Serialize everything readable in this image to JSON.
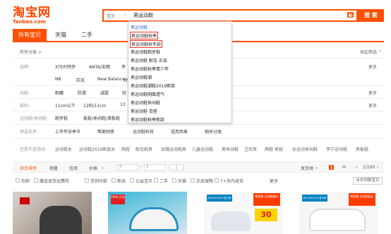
{
  "header": {
    "logo_main": "淘宝网",
    "logo_sub": "Taobao.com",
    "search_category": "宝贝",
    "search_value": "男运动鞋",
    "search_button": "搜 索"
  },
  "tabs": [
    {
      "label": "所有宝贝",
      "active": true
    },
    {
      "label": "天猫",
      "active": false
    },
    {
      "label": "二手",
      "active": false
    }
  ],
  "crumb": "所有分类 >",
  "collapse_filter": "收起筛选 ^",
  "filters": {
    "brand_label": "品牌:",
    "brand_row1": [
      "XTEP/特步",
      "ANTA/安踏",
      "李"
    ],
    "brand_row2": [
      "NB",
      "匹克",
      "New Balance",
      "特"
    ],
    "function_label": "功能:",
    "functions": [
      "耐磨",
      "防滑",
      "减震",
      "轻"
    ],
    "size_label": "鞋码:",
    "sizes": [
      "11cm以下",
      "12码/11cm",
      "13"
    ],
    "more": "更多",
    "scene_label": "运动鞋/休闲鞋:",
    "scenes": [
      "跑步鞋",
      "板鞋/休闲鞋/滑板鞋"
    ],
    "filter_cond_label": "筛选条件:",
    "filter_conds": [
      "上市年份季节",
      "帮面材质",
      "运动鞋科技",
      "适用场景",
      "相关分类"
    ],
    "guess_label": "您是不是想找:",
    "guesses": [
      "运动鞋女",
      "运动鞋2019新款女",
      "两鞋",
      "耐克鞋男",
      "安踏运动鞋男",
      "儿童运动鞋",
      "男休闲鞋",
      "卫衣男",
      "两鞋 男鞋",
      "女运动休闲鞋",
      "李宁运动鞋",
      "男板鞋"
    ]
  },
  "sortbar": {
    "items": [
      "综合排序",
      "销量",
      "信用",
      "价格"
    ],
    "price_from": "¥",
    "price_to": "¥",
    "ship_from": "发货地",
    "page": "1/100"
  },
  "filter_checks": [
    "包邮",
    "赠送退货运费险",
    "货到付款",
    "新品",
    "公益宝贝",
    "二手",
    "天猫",
    "正品保障",
    "7+天内退货"
  ],
  "filter_more": "更多",
  "shop_link": "合并同款宝贝",
  "dropdown": {
    "items": [
      "男运动鞋",
      "男运动鞋秋季",
      "男运动鞋秋冬款",
      "男运动鞋跑步鞋",
      "男运动鞋 耐克 正品",
      "男运动鞋秋季青少年",
      "男运动鞋潮",
      "男运动鞋潮鞋2019新款",
      "男运动鞋网面透气",
      "男运动鞋休闲鞋",
      "男运动鞋 百搭",
      "男运动鞋秋季新款"
    ],
    "highlighted": [
      1,
      2
    ]
  },
  "products": [
    {
      "badge": ""
    },
    {
      "badge": "PEAK 匹克"
    },
    {
      "badge": "DECATHLON 迪卡侬",
      "promo": "聚划算 全场超级价",
      "price": "30"
    },
    {
      "badge": "DECATHLON 迪卡侬",
      "promo": "聚划算 全场超级价"
    }
  ],
  "colors": {
    "accent": "#ff5000",
    "link": "#3366cc"
  }
}
